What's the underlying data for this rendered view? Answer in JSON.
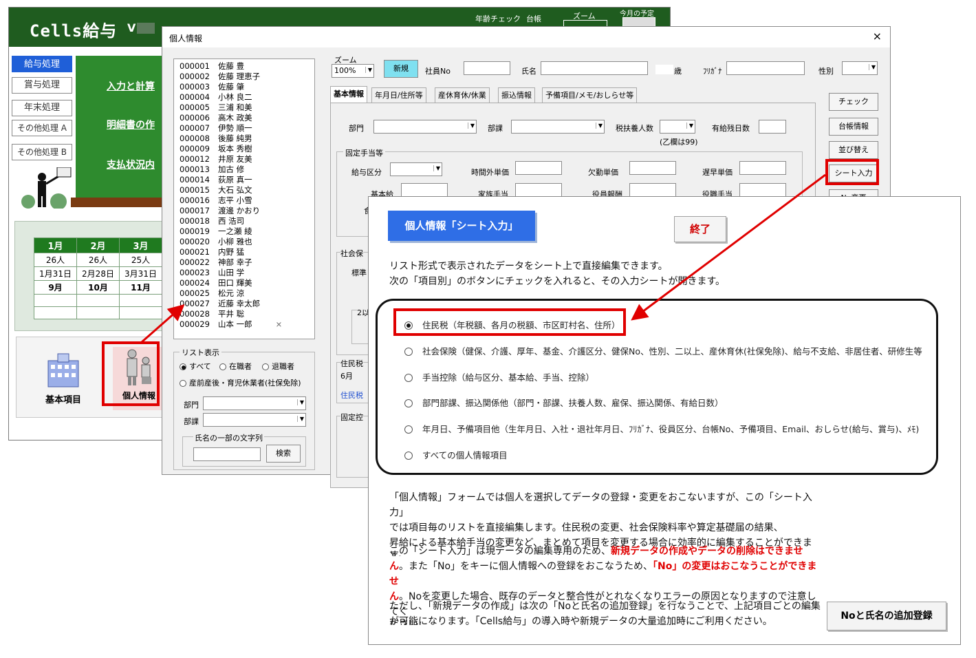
{
  "main": {
    "title": "Cells給与",
    "version_prefix": "V",
    "header_items": [
      "年齢チェック",
      "台帳",
      "ズーム",
      "今月の予定"
    ],
    "nav": [
      "給与処理",
      "賞与処理",
      "年末処理",
      "その他処理 A",
      "その他処理 B"
    ],
    "links": [
      "入力と計算",
      "明細書の作",
      "支払状況内"
    ],
    "calendar": {
      "months_top": [
        "1月",
        "2月",
        "3月"
      ],
      "counts": [
        "26人",
        "26人",
        "25人"
      ],
      "dates": [
        "1月31日",
        "2月28日",
        "3月31日"
      ],
      "months_bottom": [
        "9月",
        "10月",
        "11月"
      ]
    },
    "tray": [
      "基本項目",
      "個人情報"
    ]
  },
  "personal": {
    "title": "個人情報",
    "close": "×",
    "zoom_label": "ズーム",
    "zoom_value": "100%",
    "new_btn": "新規",
    "emp_no_label": "社員No",
    "name_label": "氏名",
    "age_suffix": "歳",
    "kana_label": "ﾌﾘｶﾞﾅ",
    "gender_label": "性別",
    "employees": [
      {
        "no": "000001",
        "name": "佐藤 豊"
      },
      {
        "no": "000002",
        "name": "佐藤 理恵子"
      },
      {
        "no": "000003",
        "name": "佐藤 肇"
      },
      {
        "no": "000004",
        "name": "小林 良二"
      },
      {
        "no": "000005",
        "name": "三浦 和美"
      },
      {
        "no": "000006",
        "name": "高木 政美"
      },
      {
        "no": "000007",
        "name": "伊勢 順一"
      },
      {
        "no": "000008",
        "name": "後藤 純男"
      },
      {
        "no": "000009",
        "name": "坂本 秀樹"
      },
      {
        "no": "000012",
        "name": "井原 友美"
      },
      {
        "no": "000013",
        "name": "加古 修"
      },
      {
        "no": "000014",
        "name": "荻原 真一"
      },
      {
        "no": "000015",
        "name": "大石 弘文"
      },
      {
        "no": "000016",
        "name": "志平 小雪"
      },
      {
        "no": "000017",
        "name": "渡邊 かおり"
      },
      {
        "no": "000018",
        "name": "西 浩司"
      },
      {
        "no": "000019",
        "name": "一之瀬 綾"
      },
      {
        "no": "000020",
        "name": "小柳 雅也"
      },
      {
        "no": "000021",
        "name": "内野 猛"
      },
      {
        "no": "000022",
        "name": "神部 幸子"
      },
      {
        "no": "000023",
        "name": "山田 学"
      },
      {
        "no": "000024",
        "name": "田口 輝美"
      },
      {
        "no": "000025",
        "name": "松元 涼"
      },
      {
        "no": "000027",
        "name": "近藤 幸太郎"
      },
      {
        "no": "000028",
        "name": "平井 聡"
      },
      {
        "no": "000029",
        "name": "山本 一郎"
      }
    ],
    "list_marker": "×",
    "list_ctrl": {
      "title": "リスト表示",
      "opt_all": "すべて",
      "opt_active": "在職者",
      "opt_retired": "退職者",
      "opt_leave": "産前産後・育児休業者(社保免除)",
      "dept": "部門",
      "section": "部課",
      "name_search": "氏名の一部の文字列",
      "search_btn": "検索"
    },
    "tabs": [
      "基本情報",
      "年月日/住所等",
      "産休育休/休業",
      "振込情報",
      "予備項目/メモ/おしらせ等"
    ],
    "fields": {
      "dept": "部門",
      "section": "部課",
      "dependents": "税扶養人数",
      "paid_leave": "有給残日数",
      "otsu_note": "(乙欄は99)",
      "fixed_group": "固定手当等",
      "pay_type": "給与区分",
      "overtime": "時間外単価",
      "absence": "欠勤単価",
      "late": "遅早単価",
      "base": "基本給",
      "family": "家族手当",
      "officer": "役員報酬",
      "position": "役職手当",
      "food": "食",
      "social": "社会保",
      "standard": "標準",
      "two_or_more": "2以",
      "resident": "住民税",
      "june": "6月",
      "resident_link": "住民税",
      "fixed_deduct": "固定控"
    },
    "side_buttons": [
      "チェック",
      "台帳情報",
      "並び替え",
      "シート入力",
      "No変更"
    ]
  },
  "sheet": {
    "title_btn": "個人情報「シート入力」",
    "end_btn": "終了",
    "desc1": "リスト形式で表示されたデータをシート上で直接編集できます。",
    "desc2": "次の「項目別」のボタンにチェックを入れると、その入力シートが開きます。",
    "options": [
      "住民税（年税額、各月の税額、市区町村名、住所）",
      "社会保険（健保、介護、厚年、基金、介護区分、健保No、性別、二以上、産休育休(社保免除)、給与不支給、非居住者、研修生等",
      "手当控除（給与区分、基本給、手当、控除）",
      "部門部課、振込関係他（部門・部課、扶養人数、雇保、振込関係、有給日数）",
      "年月日、予備項目他（生年月日、入社・退社年月日、ﾌﾘｶﾞﾅ、役員区分、台帳No、予備項目、Email、おしらせ(給与、賞与)、ﾒﾓ)",
      "すべての個人情報項目"
    ],
    "selected_option": 0,
    "para1_line1": "「個人情報」フォームでは個人を選択してデータの登録・変更をおこないますが、この「シート入力」",
    "para1_line2": "では項目毎のリストを直接編集します。住民税の変更、社会保険料率や算定基礎届の結果、",
    "para1_line3": "昇給による基本給手当の変更など、まとめて項目を変更する場合に効率的に編集することができま",
    "para1_line4": "す。",
    "para2_a": "この「シート入力」は現データの編集専用のため、",
    "para2_red1": "新規データの作成やデータの削除はできませ",
    "para2_red1b": "ん",
    "para2_b": "。また「No」をキーに個人情報への登録をおこなうため、",
    "para2_red2": "「No」の変更はおこなうことができませ",
    "para2_red2b": "ん",
    "para2_c": "。Noを変更した場合、既存のデータと整合性がとれなくなりエラーの原因となりますので注意してく",
    "para2_d": "ださい。",
    "para3_line1": "ただし、「新規データの作成」は次の「Noと氏名の追加登録」を行なうことで、上記項目ごとの編集",
    "para3_line2": "が可能になります。「Cells給与」の導入時や新規データの大量追加時にご利用ください。",
    "add_btn": "Noと氏名の追加登録"
  },
  "colors": {
    "highlight": "#e00000",
    "brand_green": "#1f5c1f",
    "primary_blue": "#2f6ee6"
  }
}
